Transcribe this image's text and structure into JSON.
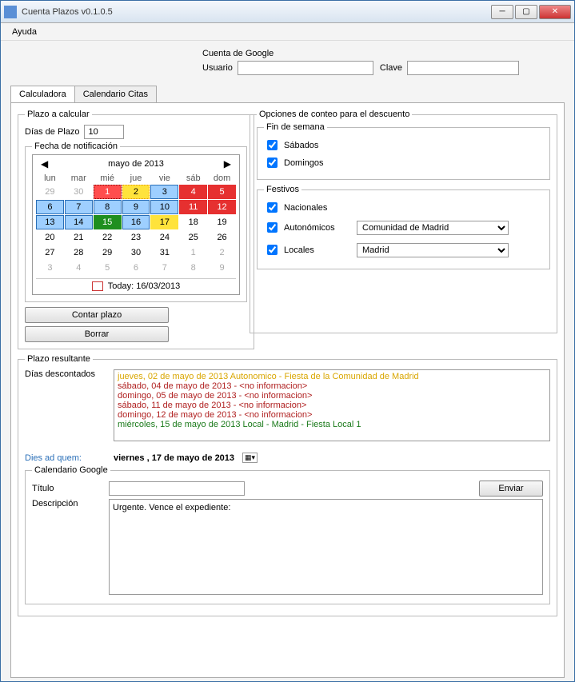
{
  "window": {
    "title": "Cuenta Plazos v0.1.0.5"
  },
  "menu": {
    "ayuda": "Ayuda"
  },
  "google": {
    "section": "Cuenta de Google",
    "usuario_label": "Usuario",
    "clave_label": "Clave",
    "usuario": "",
    "clave": ""
  },
  "tabs": {
    "calculadora": "Calculadora",
    "citas": "Calendario Citas"
  },
  "plazo_calcular": {
    "legend": "Plazo a calcular",
    "dias_label": "Días de Plazo",
    "dias_value": "10",
    "fecha_legend": "Fecha de notificación"
  },
  "calendar": {
    "title": "mayo de 2013",
    "dow": [
      "lun",
      "mar",
      "mié",
      "jue",
      "vie",
      "sáb",
      "dom"
    ],
    "today_label": "Today: 16/03/2013",
    "cells": [
      {
        "d": "29",
        "cls": "off"
      },
      {
        "d": "30",
        "cls": "off"
      },
      {
        "d": "1",
        "cls": "pink"
      },
      {
        "d": "2",
        "cls": "ydash"
      },
      {
        "d": "3",
        "cls": "blue"
      },
      {
        "d": "4",
        "cls": "red"
      },
      {
        "d": "5",
        "cls": "red"
      },
      {
        "d": "6",
        "cls": "blue"
      },
      {
        "d": "7",
        "cls": "blue"
      },
      {
        "d": "8",
        "cls": "blue"
      },
      {
        "d": "9",
        "cls": "blue"
      },
      {
        "d": "10",
        "cls": "blue"
      },
      {
        "d": "11",
        "cls": "red"
      },
      {
        "d": "12",
        "cls": "red"
      },
      {
        "d": "13",
        "cls": "blue"
      },
      {
        "d": "14",
        "cls": "blue"
      },
      {
        "d": "15",
        "cls": "green"
      },
      {
        "d": "16",
        "cls": "blue"
      },
      {
        "d": "17",
        "cls": "yellow"
      },
      {
        "d": "18",
        "cls": ""
      },
      {
        "d": "19",
        "cls": ""
      },
      {
        "d": "20",
        "cls": ""
      },
      {
        "d": "21",
        "cls": ""
      },
      {
        "d": "22",
        "cls": ""
      },
      {
        "d": "23",
        "cls": ""
      },
      {
        "d": "24",
        "cls": ""
      },
      {
        "d": "25",
        "cls": ""
      },
      {
        "d": "26",
        "cls": ""
      },
      {
        "d": "27",
        "cls": ""
      },
      {
        "d": "28",
        "cls": ""
      },
      {
        "d": "29",
        "cls": ""
      },
      {
        "d": "30",
        "cls": ""
      },
      {
        "d": "31",
        "cls": ""
      },
      {
        "d": "1",
        "cls": "off"
      },
      {
        "d": "2",
        "cls": "off"
      },
      {
        "d": "3",
        "cls": "off"
      },
      {
        "d": "4",
        "cls": "off"
      },
      {
        "d": "5",
        "cls": "off"
      },
      {
        "d": "6",
        "cls": "off"
      },
      {
        "d": "7",
        "cls": "off"
      },
      {
        "d": "8",
        "cls": "off"
      },
      {
        "d": "9",
        "cls": "off"
      }
    ]
  },
  "buttons": {
    "contar": "Contar plazo",
    "borrar": "Borrar",
    "enviar": "Enviar"
  },
  "opciones": {
    "legend": "Opciones de conteo para el descuento",
    "finde_legend": "Fin de semana",
    "sabados": "Sábados",
    "domingos": "Domingos",
    "festivos_legend": "Festivos",
    "nacionales": "Nacionales",
    "autonomicos": "Autonómicos",
    "locales": "Locales",
    "comunidad": "Comunidad de Madrid",
    "localidad": "Madrid"
  },
  "resultado": {
    "legend": "Plazo resultante",
    "dias_desc_label": "Días descontados",
    "lines": [
      {
        "cls": "line-orange",
        "text": "jueves, 02 de mayo de 2013   Autonomico - Fiesta de la Comunidad de Madrid"
      },
      {
        "cls": "line-red",
        "text": "sábado, 04 de mayo de 2013    - <no informacion>"
      },
      {
        "cls": "line-red",
        "text": "domingo, 05 de mayo de 2013  - <no informacion>"
      },
      {
        "cls": "line-red",
        "text": "sábado, 11 de mayo de 2013    - <no informacion>"
      },
      {
        "cls": "line-red",
        "text": "domingo, 12 de mayo de 2013  - <no informacion>"
      },
      {
        "cls": "line-green",
        "text": "miércoles, 15 de mayo de 2013   Local - Madrid - Fiesta Local 1"
      }
    ],
    "dies_label": "Dies ad quem:",
    "dies_value": "viernes  , 17 de    mayo    de 2013"
  },
  "cal_google": {
    "legend": "Calendario Google",
    "titulo_label": "Título",
    "titulo_value": "",
    "desc_label": "Descripción",
    "desc_value": "Urgente. Vence el expediente:"
  }
}
